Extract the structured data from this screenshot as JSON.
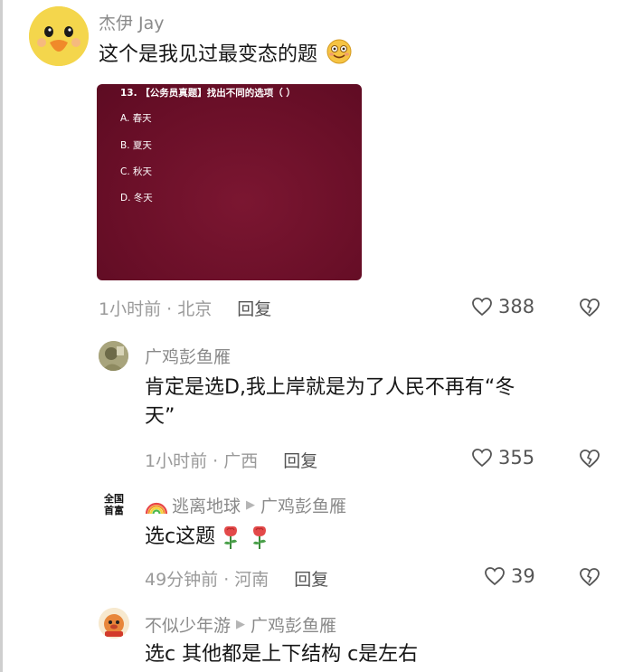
{
  "comments": [
    {
      "username": "杰伊 Jay",
      "text": "这个是我见过最变态的题",
      "question_image": {
        "title": "13. 【公务员真题】找出不同的选项（ ）",
        "options": [
          "A. 春天",
          "B. 夏天",
          "C. 秋天",
          "D. 冬天"
        ]
      },
      "time": "1小时前 · 北京",
      "reply_label": "回复",
      "likes": "388"
    },
    {
      "username": "广鸡彭鱼雁",
      "text_line1": "肯定是选D,我上岸就是为了人民不再有“冬",
      "text_line2": "天”",
      "time": "1小时前 · 广西",
      "reply_label": "回复",
      "likes": "355"
    },
    {
      "username": "逃离地球",
      "reply_to": "广鸡彭鱼雁",
      "avatar_text": "全国首富",
      "text": "选c这题",
      "time": "49分钟前 · 河南",
      "reply_label": "回复",
      "likes": "39"
    },
    {
      "username": "不似少年游",
      "reply_to": "广鸡彭鱼雁",
      "text": "选c 其他都是上下结构 c是左右"
    }
  ],
  "icons": {
    "like": "heart-outline-icon",
    "dislike": "broken-heart-icon",
    "reply_arrow": "triangle-right-icon"
  },
  "colors": {
    "meta": "#9a9a9a",
    "card_bg": "#6a0f28"
  }
}
